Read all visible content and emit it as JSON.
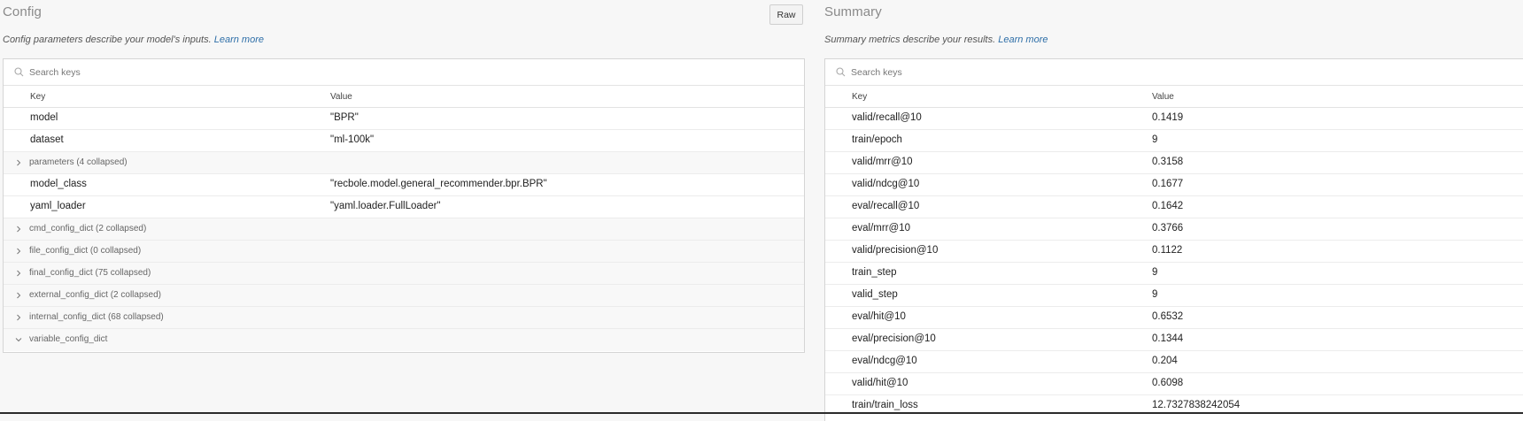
{
  "config": {
    "title": "Config",
    "raw_button": "Raw",
    "description": "Config parameters describe your model's inputs.",
    "learn_more": "Learn more",
    "search_placeholder": "Search keys",
    "header": {
      "key": "Key",
      "value": "Value"
    },
    "rows": [
      {
        "type": "pair",
        "key": "model",
        "value": "\"BPR\""
      },
      {
        "type": "pair",
        "key": "dataset",
        "value": "\"ml-100k\""
      },
      {
        "type": "group",
        "label": "parameters (4 collapsed)",
        "expanded": false
      },
      {
        "type": "pair",
        "key": "model_class",
        "value": "\"recbole.model.general_recommender.bpr.BPR\""
      },
      {
        "type": "pair",
        "key": "yaml_loader",
        "value": "\"yaml.loader.FullLoader\""
      },
      {
        "type": "group",
        "label": "cmd_config_dict (2 collapsed)",
        "expanded": false
      },
      {
        "type": "group",
        "label": "file_config_dict (0 collapsed)",
        "expanded": false
      },
      {
        "type": "group",
        "label": "final_config_dict (75 collapsed)",
        "expanded": false
      },
      {
        "type": "group",
        "label": "external_config_dict (2 collapsed)",
        "expanded": false
      },
      {
        "type": "group",
        "label": "internal_config_dict (68 collapsed)",
        "expanded": false
      },
      {
        "type": "group",
        "label": "variable_config_dict",
        "expanded": true
      }
    ]
  },
  "summary": {
    "title": "Summary",
    "description": "Summary metrics describe your results.",
    "learn_more": "Learn more",
    "search_placeholder": "Search keys",
    "header": {
      "key": "Key",
      "value": "Value"
    },
    "rows": [
      {
        "key": "valid/recall@10",
        "value": "0.1419"
      },
      {
        "key": "train/epoch",
        "value": "9"
      },
      {
        "key": "valid/mrr@10",
        "value": "0.3158"
      },
      {
        "key": "valid/ndcg@10",
        "value": "0.1677"
      },
      {
        "key": "eval/recall@10",
        "value": "0.1642"
      },
      {
        "key": "eval/mrr@10",
        "value": "0.3766"
      },
      {
        "key": "valid/precision@10",
        "value": "0.1122"
      },
      {
        "key": "train_step",
        "value": "9"
      },
      {
        "key": "valid_step",
        "value": "9"
      },
      {
        "key": "eval/hit@10",
        "value": "0.6532"
      },
      {
        "key": "eval/precision@10",
        "value": "0.1344"
      },
      {
        "key": "eval/ndcg@10",
        "value": "0.204"
      },
      {
        "key": "valid/hit@10",
        "value": "0.6098"
      },
      {
        "key": "train/train_loss",
        "value": "12.7327838242054"
      }
    ]
  }
}
